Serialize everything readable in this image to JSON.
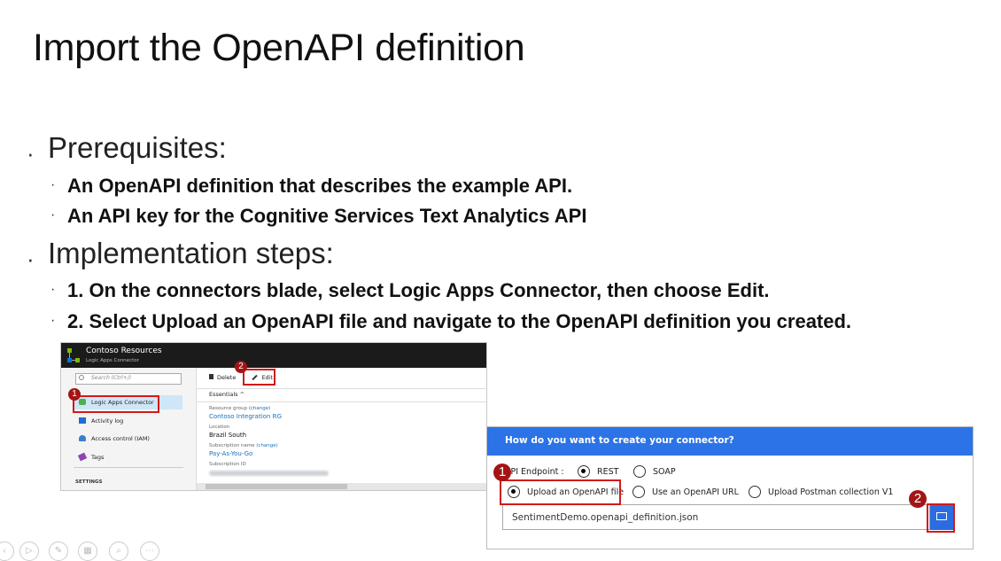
{
  "slide": {
    "title": "Import the OpenAPI definition",
    "bullets": [
      {
        "heading": "Prerequisites:",
        "items": [
          "An OpenAPI definition that describes the example API.",
          "An API key for the Cognitive Services Text Analytics API"
        ]
      },
      {
        "heading": "Implementation steps:",
        "items": [
          "1. On the connectors blade, select Logic Apps Connector, then choose Edit.",
          "2. Select Upload an OpenAPI file and navigate to the OpenAPI definition you created."
        ]
      }
    ]
  },
  "portal": {
    "header_title": "Contoso Resources",
    "header_subtitle": "Logic Apps Connector",
    "search_placeholder": "Search (Ctrl+/)",
    "menu": [
      "Logic Apps Connector",
      "Activity log",
      "Access control (IAM)",
      "Tags"
    ],
    "settings_label": "SETTINGS",
    "toolbar": {
      "delete": "Delete",
      "edit": "Edit"
    },
    "essentials_label": "Essentials",
    "essentials_chevron": "^",
    "fields": [
      {
        "key": "Resource group",
        "change": "(change)",
        "value": "Contoso Integration RG"
      },
      {
        "key": "Location",
        "value": "Brazil South"
      },
      {
        "key": "Subscription name",
        "change": "(change)",
        "value": "Pay-As-You-Go"
      },
      {
        "key": "Subscription ID"
      }
    ],
    "badges": [
      "1",
      "2"
    ]
  },
  "dialog": {
    "header": "How do you want to create your connector?",
    "api_endpoint_label": "API Endpoint :",
    "endpoint_options": [
      "REST",
      "SOAP"
    ],
    "selected_endpoint": "REST",
    "import_options": [
      "Upload an OpenAPI file",
      "Use an OpenAPI URL",
      "Upload Postman collection V1"
    ],
    "selected_import": "Upload an OpenAPI file",
    "file_value": "SentimentDemo.openapi_definition.json",
    "badges": [
      "1",
      "2"
    ]
  },
  "colors": {
    "accent_blue": "#2b73e6",
    "highlight_red": "#d01b1b",
    "badge_red": "#a31515",
    "portal_header": "#1b1b1b"
  }
}
